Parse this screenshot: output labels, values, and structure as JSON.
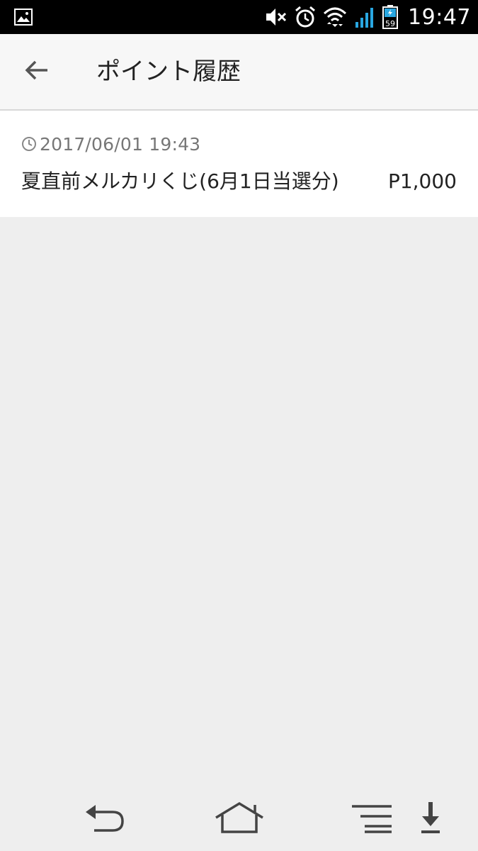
{
  "status_bar": {
    "time": "19:47",
    "battery_level": "59",
    "icons": [
      "gallery-notification-icon",
      "mute-icon",
      "alarm-icon",
      "wifi-icon",
      "signal-icon",
      "battery-icon"
    ]
  },
  "header": {
    "title": "ポイント履歴",
    "back_icon": "arrow-left-icon"
  },
  "history": {
    "items": [
      {
        "date": "2017/06/01 19:43",
        "title": "夏直前メルカリくじ(6月1日当選分)",
        "points": "P1,000"
      }
    ]
  },
  "nav_bar": {
    "icons": [
      "nav-back-icon",
      "nav-home-icon",
      "nav-menu-icon",
      "nav-download-icon"
    ]
  },
  "colors": {
    "status_bar_bg": "#000000",
    "app_bar_bg": "#f7f7f7",
    "list_bg": "#ffffff",
    "page_bg": "#eeeeee",
    "date_text": "#777777",
    "primary_text": "#222222",
    "signal_accent": "#29a7e1"
  }
}
